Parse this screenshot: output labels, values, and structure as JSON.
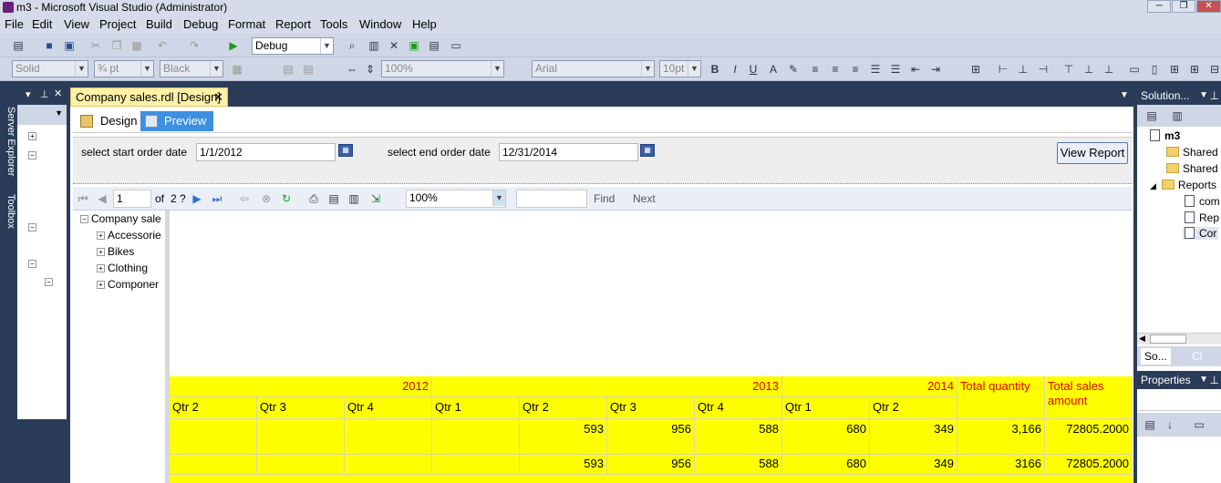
{
  "window": {
    "title": "m3 - Microsoft Visual Studio (Administrator)"
  },
  "menu": [
    "File",
    "Edit",
    "View",
    "Project",
    "Build",
    "Debug",
    "Format",
    "Report",
    "Tools",
    "Window",
    "Help"
  ],
  "toolbar1": {
    "config": "Debug"
  },
  "toolbar2": {
    "line_style": "Solid",
    "line_width": "¾ pt",
    "line_color": "Black",
    "zoom": "100%",
    "font": "Arial",
    "font_size": "10pt"
  },
  "left_side": {
    "tabs": [
      "Server Explorer",
      "Toolbox"
    ]
  },
  "document": {
    "tab_title": "Company sales.rdl [Design]",
    "subtabs": [
      "Design",
      "Preview"
    ],
    "params": {
      "start_label": "select start order date",
      "start_value": "1/1/2012",
      "end_label": "select end order date",
      "end_value": "12/31/2014",
      "view_button": "View Report"
    },
    "report_toolbar": {
      "page": "1",
      "of_label": "of",
      "total_pages": "2 ?",
      "zoom": "100%",
      "find": "Find",
      "next": "Next"
    },
    "tree": {
      "root": "Company sale",
      "children": [
        "Accessorie",
        "Bikes",
        "Clothing",
        "Componer"
      ]
    },
    "table": {
      "years": [
        "2012",
        "2013",
        "2014"
      ],
      "total_quantity": "Total quantity",
      "total_sales": "Total sales amount",
      "quarters": [
        "Qtr 2",
        "Qtr 3",
        "Qtr 4",
        "Qtr 1",
        "Qtr 2",
        "Qtr 3",
        "Qtr 4",
        "Qtr 1",
        "Qtr 2"
      ],
      "row1": [
        "",
        "",
        "",
        "",
        "593",
        "956",
        "588",
        "680",
        "349",
        "3,166",
        "72805.2000"
      ],
      "row2": [
        "",
        "",
        "",
        "",
        "593",
        "956",
        "588",
        "680",
        "349",
        "3166",
        "72805.2000"
      ]
    }
  },
  "solution": {
    "title": "Solution...",
    "project": "m3",
    "items": [
      "Shared",
      "Shared",
      "Reports",
      "com",
      "Rep",
      "Cor"
    ],
    "tabs": [
      "So...",
      "Cl"
    ]
  },
  "properties": {
    "title": "Properties"
  }
}
